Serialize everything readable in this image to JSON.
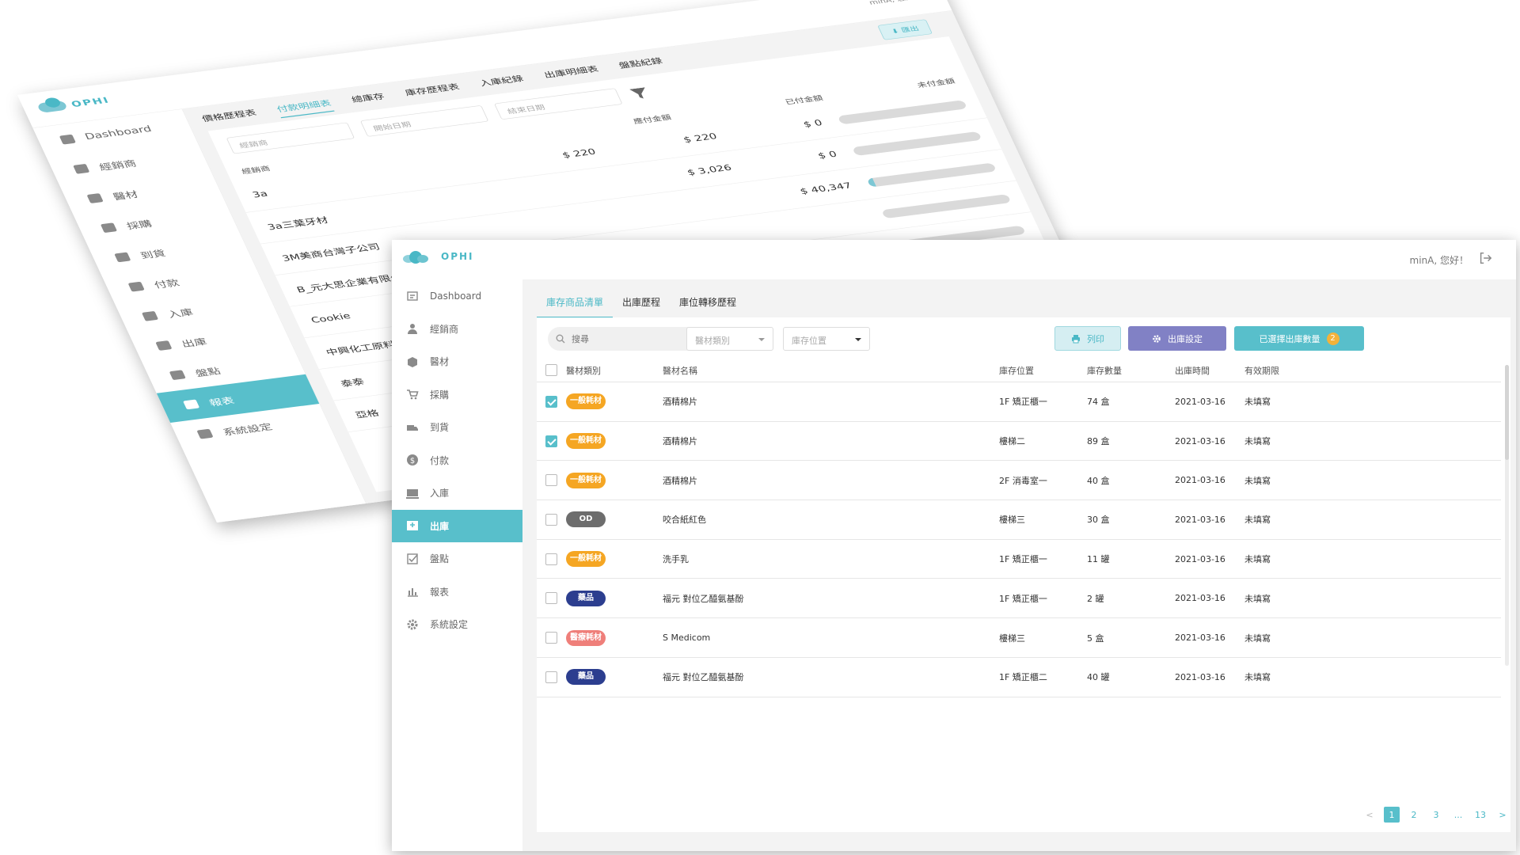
{
  "back_window": {
    "logo_text": "OPHI",
    "greeting": "minA, 您好！",
    "sidebar": [
      {
        "label": "Dashboard",
        "icon": "dashboard-icon"
      },
      {
        "label": "經銷商",
        "icon": "user-icon"
      },
      {
        "label": "醫材",
        "icon": "box-icon"
      },
      {
        "label": "採購",
        "icon": "cart-icon"
      },
      {
        "label": "到貨",
        "icon": "truck-icon"
      },
      {
        "label": "付款",
        "icon": "dollar-icon"
      },
      {
        "label": "入庫",
        "icon": "inbound-icon"
      },
      {
        "label": "出庫",
        "icon": "outbound-icon"
      },
      {
        "label": "盤點",
        "icon": "checklist-icon"
      },
      {
        "label": "報表",
        "icon": "bar-chart-icon",
        "active": true
      },
      {
        "label": "系統設定",
        "icon": "gear-icon"
      }
    ],
    "tabs": [
      "價格歷程表",
      "付款明細表",
      "總庫存",
      "庫存歷程表",
      "入庫紀錄",
      "出庫明細表",
      "盤點紀錄"
    ],
    "active_tab": 1,
    "export_label": "匯出",
    "filters": [
      "經銷商",
      "開始日期",
      "結束日期"
    ],
    "columns": [
      "經銷商",
      "應付金額",
      "已付金額",
      "未付金額"
    ],
    "rows": [
      {
        "dealer": "3a",
        "due": "$ 220",
        "paid": "$ 220",
        "unpaid": "$ 0",
        "progress": 0
      },
      {
        "dealer": "3a三葉牙材",
        "due": "",
        "paid": "$ 3,026",
        "unpaid": "$ 0",
        "progress": 0
      },
      {
        "dealer": "3M美商台灣子公司",
        "due": "",
        "paid": "",
        "unpaid": "$ 40,347",
        "progress": 0.05
      },
      {
        "dealer": "B_元大思企業有限公司",
        "due": "",
        "paid": "",
        "unpaid": "",
        "progress": 0
      },
      {
        "dealer": "Cookie",
        "due": "",
        "paid": "",
        "unpaid": "",
        "progress": 0
      },
      {
        "dealer": "中興化工原料",
        "due": "",
        "paid": "",
        "unpaid": "",
        "progress": 0
      },
      {
        "dealer": "泰泰",
        "due": "",
        "paid": "",
        "unpaid": "",
        "progress": 0
      },
      {
        "dealer": "亞格",
        "due": "",
        "paid": "",
        "unpaid": "",
        "progress": 0
      }
    ]
  },
  "front_window": {
    "logo_text": "OPHI",
    "greeting": "minA, 您好！",
    "sidebar": [
      {
        "label": "Dashboard",
        "icon": "dashboard-icon"
      },
      {
        "label": "經銷商",
        "icon": "user-icon"
      },
      {
        "label": "醫材",
        "icon": "box-icon"
      },
      {
        "label": "採購",
        "icon": "cart-icon"
      },
      {
        "label": "到貨",
        "icon": "truck-icon"
      },
      {
        "label": "付款",
        "icon": "dollar-icon"
      },
      {
        "label": "入庫",
        "icon": "inbound-icon"
      },
      {
        "label": "出庫",
        "icon": "outbound-icon",
        "active": true
      },
      {
        "label": "盤點",
        "icon": "checklist-icon"
      },
      {
        "label": "報表",
        "icon": "bar-chart-icon"
      },
      {
        "label": "系統設定",
        "icon": "gear-icon"
      }
    ],
    "tabs": [
      "庫存商品清單",
      "出庫歷程",
      "庫位轉移歷程"
    ],
    "active_tab": 0,
    "search_placeholder": "搜尋",
    "category_select": "醫材類別",
    "location_select": "庫存位置",
    "print_label": "列印",
    "settings_label": "出庫設定",
    "selected_label": "已選擇出庫數量",
    "selected_count": "2",
    "columns": [
      "醫材類別",
      "醫材名稱",
      "庫存位置",
      "庫存數量",
      "出庫時間",
      "有效期限"
    ],
    "rows": [
      {
        "checked": true,
        "category": "一般耗材",
        "cat_color": "#f5a623",
        "name": "酒精棉片",
        "location": "1F 矯正櫃一",
        "qty": "74 盒",
        "date": "2021-03-16",
        "expiry": "未填寫"
      },
      {
        "checked": true,
        "category": "一般耗材",
        "cat_color": "#f5a623",
        "name": "酒精棉片",
        "location": "樓梯二",
        "qty": "89 盒",
        "date": "2021-03-16",
        "expiry": "未填寫"
      },
      {
        "checked": false,
        "category": "一般耗材",
        "cat_color": "#f5a623",
        "name": "酒精棉片",
        "location": "2F 消毒室一",
        "qty": "40 盒",
        "date": "2021-03-16",
        "expiry": "未填寫"
      },
      {
        "checked": false,
        "category": "OD",
        "cat_color": "#6d6d6d",
        "name": "咬合紙紅色",
        "location": "樓梯三",
        "qty": "30 盒",
        "date": "2021-03-16",
        "expiry": "未填寫"
      },
      {
        "checked": false,
        "category": "一般耗材",
        "cat_color": "#f5a623",
        "name": "洗手乳",
        "location": "1F 矯正櫃一",
        "qty": "11 罐",
        "date": "2021-03-16",
        "expiry": "未填寫"
      },
      {
        "checked": false,
        "category": "藥品",
        "cat_color": "#2c3e8f",
        "name": "福元 對位乙醯氨基酚",
        "location": "1F 矯正櫃一",
        "qty": "2 罐",
        "date": "2021-03-16",
        "expiry": "未填寫"
      },
      {
        "checked": false,
        "category": "醫療耗材",
        "cat_color": "#ef7f7a",
        "name": "S Medicom",
        "location": "樓梯三",
        "qty": "5 盒",
        "date": "2021-03-16",
        "expiry": "未填寫"
      },
      {
        "checked": false,
        "category": "藥品",
        "cat_color": "#2c3e8f",
        "name": "福元 對位乙醯氨基酚",
        "location": "1F 矯正櫃二",
        "qty": "40 罐",
        "date": "2021-03-16",
        "expiry": "未填寫"
      }
    ],
    "pagination": {
      "prev": "<",
      "pages": [
        "1",
        "2",
        "3",
        "...",
        "13"
      ],
      "current": "1",
      "next": ">"
    }
  }
}
